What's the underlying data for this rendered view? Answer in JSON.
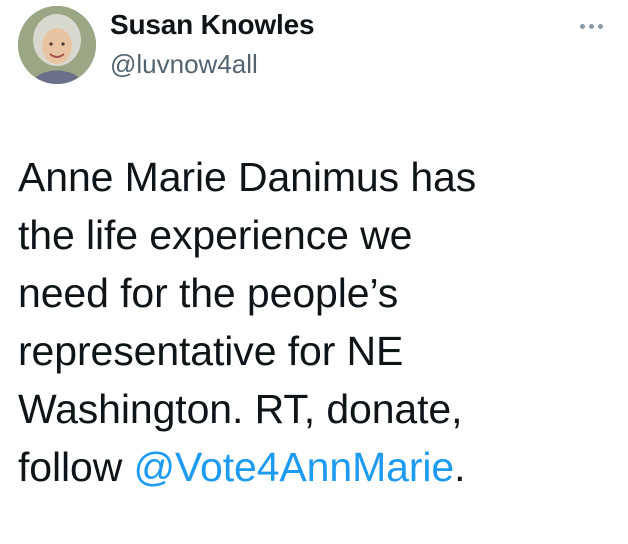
{
  "author": {
    "display_name": "Susan Knowles",
    "handle": "@luvnow4all"
  },
  "menu": {
    "more_icon": "more-horizontal-icon"
  },
  "tweet": {
    "lines": [
      "Anne Marie Danimus has",
      "the life experience we",
      "need for the people’s",
      "representative for NE",
      "Washington. RT, donate,"
    ],
    "last_line_prefix": "follow ",
    "mention": "@Vote4AnnMarie",
    "last_line_suffix": "."
  },
  "colors": {
    "text": "#0f1419",
    "secondary_text": "#536471",
    "link": "#1d9bf0",
    "background": "#ffffff"
  }
}
